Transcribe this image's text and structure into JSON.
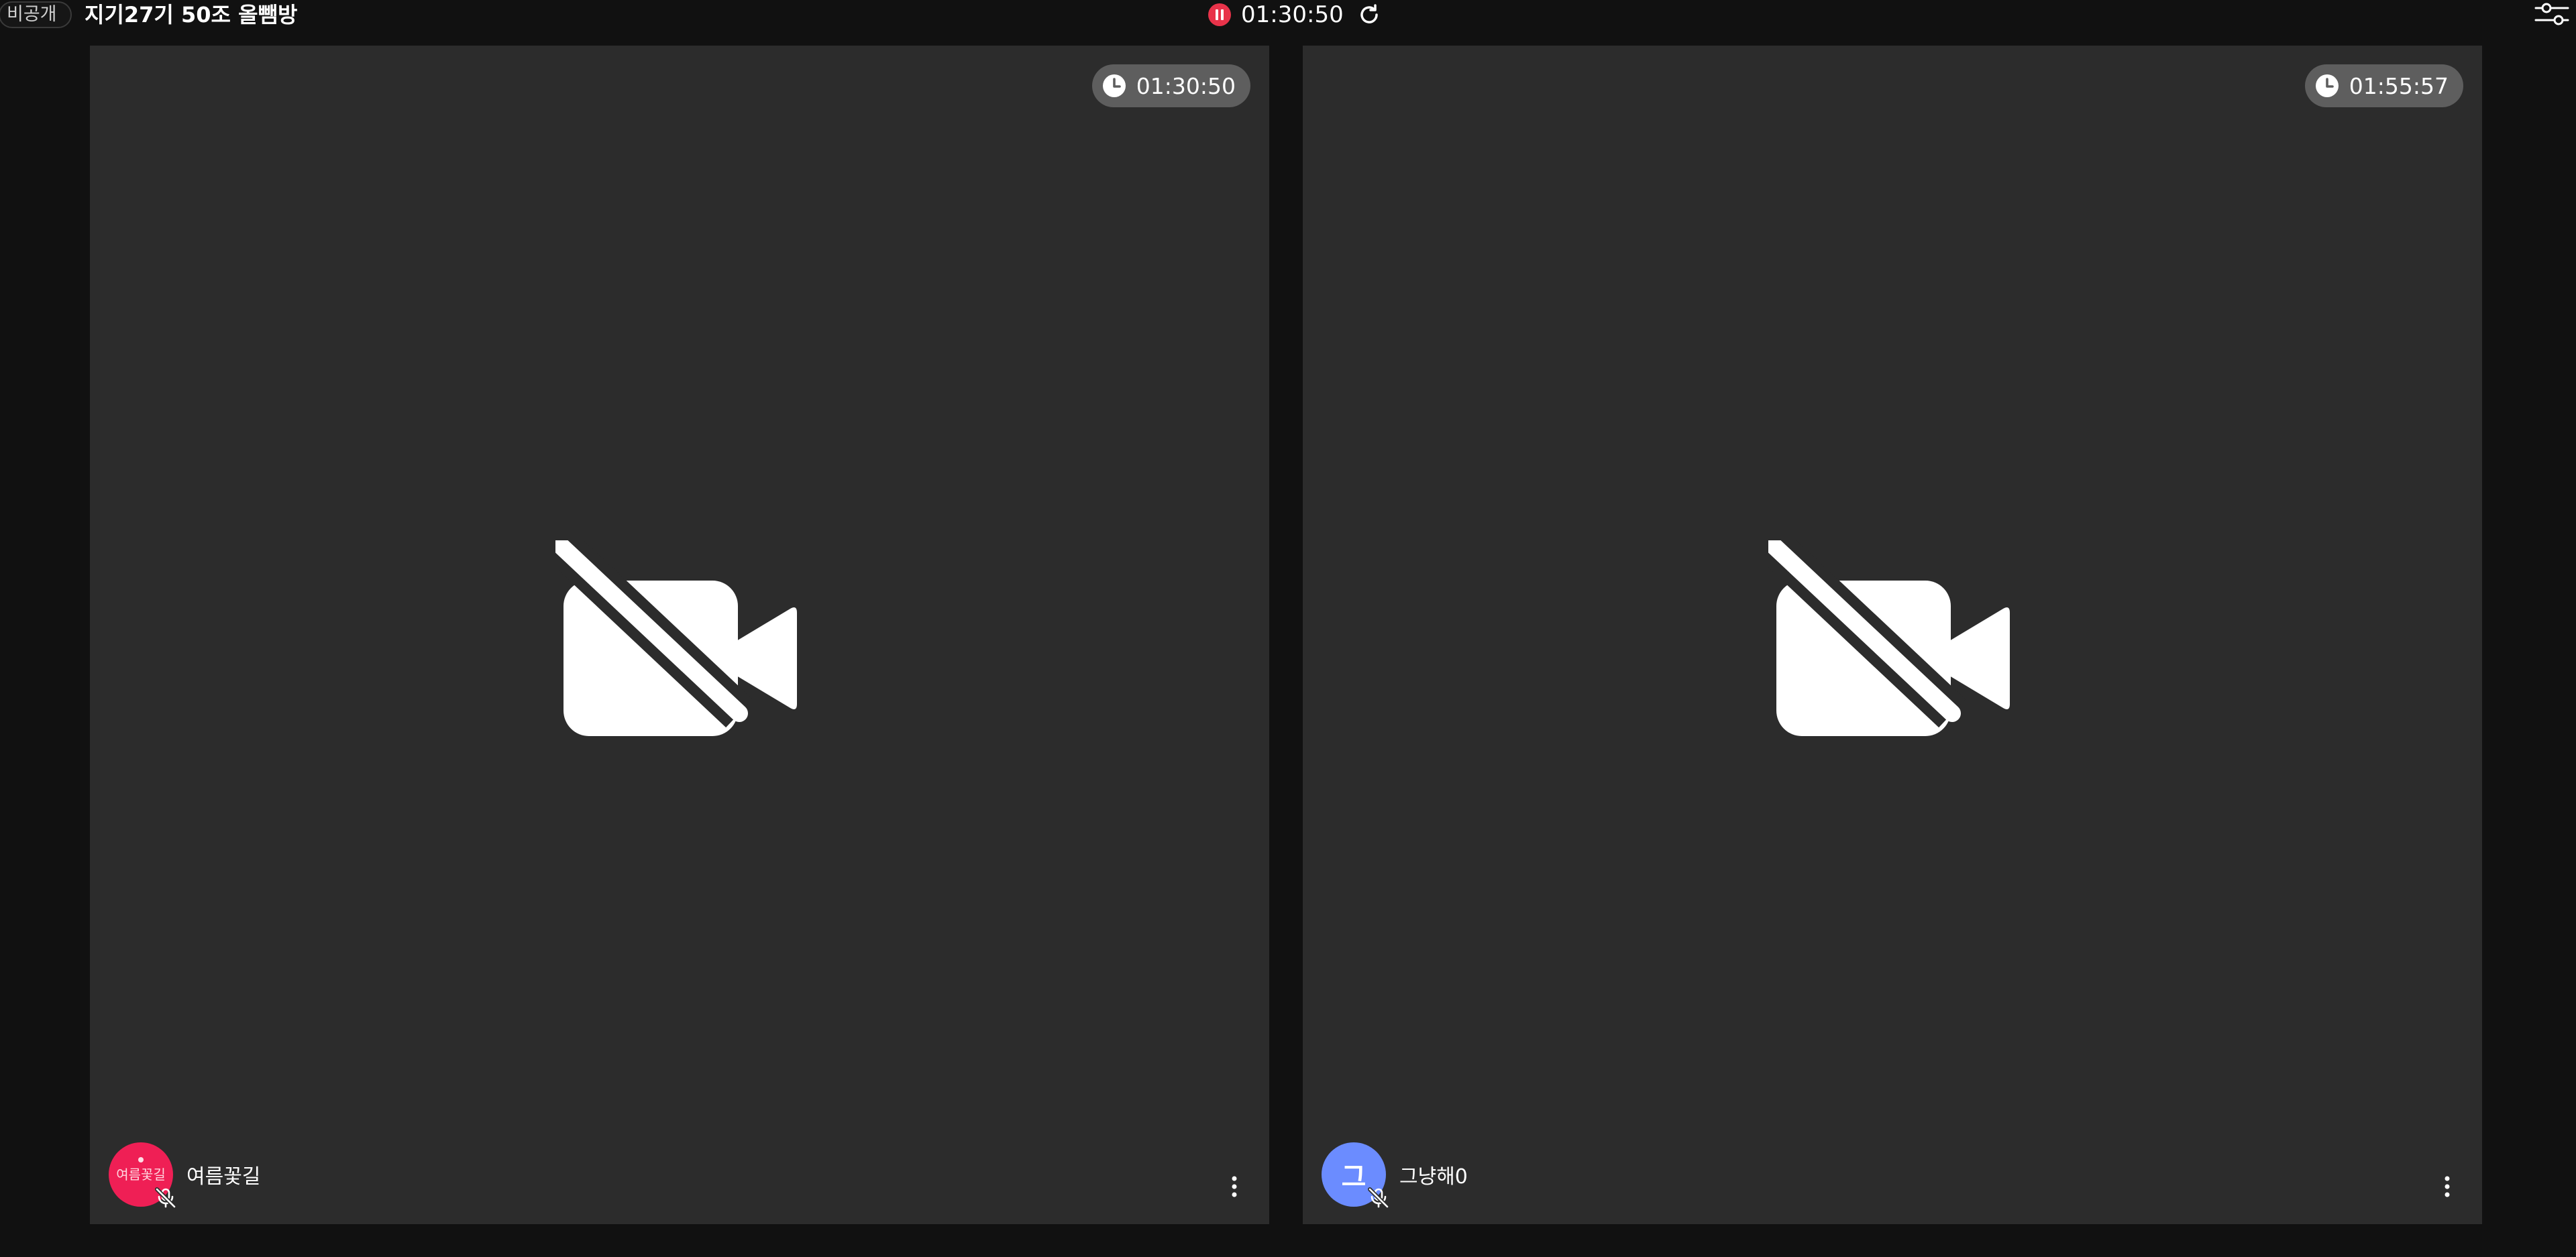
{
  "header": {
    "privacy_label": "비공개",
    "room_title": "지기27기 50조 올뺌방",
    "session_time": "01:30:50",
    "accent_color": "#e8334a"
  },
  "tiles": [
    {
      "timer": "01:30:50",
      "username": "여름꽃길",
      "avatar_text": "여름꽃길",
      "avatar_color": "#ef1f55",
      "camera": "off",
      "mic": "off"
    },
    {
      "timer": "01:55:57",
      "username": "그냥해0",
      "avatar_text": "그",
      "avatar_color": "#6b8cff",
      "camera": "off",
      "mic": "off"
    }
  ],
  "icons": {
    "pause": "pause-circle-icon",
    "refresh": "refresh-icon",
    "settings": "sliders-icon",
    "clock": "clock-icon",
    "camera_off": "camera-off-icon",
    "mic_off": "mic-off-icon",
    "more": "more-vertical-icon"
  }
}
